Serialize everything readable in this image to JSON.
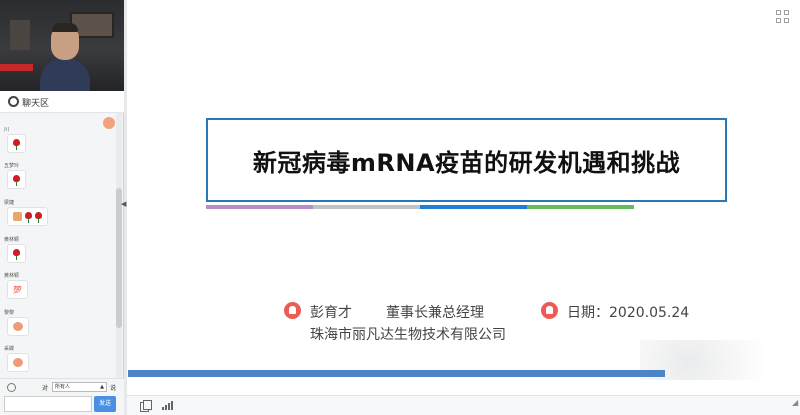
{
  "chat": {
    "title": "聊天区",
    "messages": [
      {
        "name": "川",
        "items": [
          "rose"
        ]
      },
      {
        "name": "五梦玲",
        "items": [
          "rose"
        ]
      },
      {
        "name": "梁婕",
        "items": [
          "thumbs-up",
          "rose",
          "rose"
        ]
      },
      {
        "name": "黄林颖",
        "items": [
          "rose"
        ]
      },
      {
        "name": "黄林颖",
        "items": [
          "hundred"
        ]
      },
      {
        "name": "黎黎",
        "items": [
          "clap"
        ]
      },
      {
        "name": "采蝶",
        "items": [
          "clap"
        ]
      }
    ],
    "hundred_glyph": "💯",
    "to_label": "对",
    "recipient": "所有人",
    "say_label": "说",
    "send_label": "发送"
  },
  "slide": {
    "title": "新冠病毒mRNA疫苗的研发机遇和挑战",
    "presenter_name": "彭育才",
    "presenter_role": "董事长兼总经理",
    "company": "珠海市丽凡达生物技术有限公司",
    "date_label": "日期：2020.05.24",
    "accent_colors": [
      "#b38fc4",
      "#bfc3c7",
      "#1e7fd4",
      "#63bd5f"
    ]
  },
  "colors": {
    "title_border": "#2778b9",
    "progress_bar": "#4d83c7",
    "icon_red": "#ec5b56",
    "send_button": "#4a90e2"
  }
}
